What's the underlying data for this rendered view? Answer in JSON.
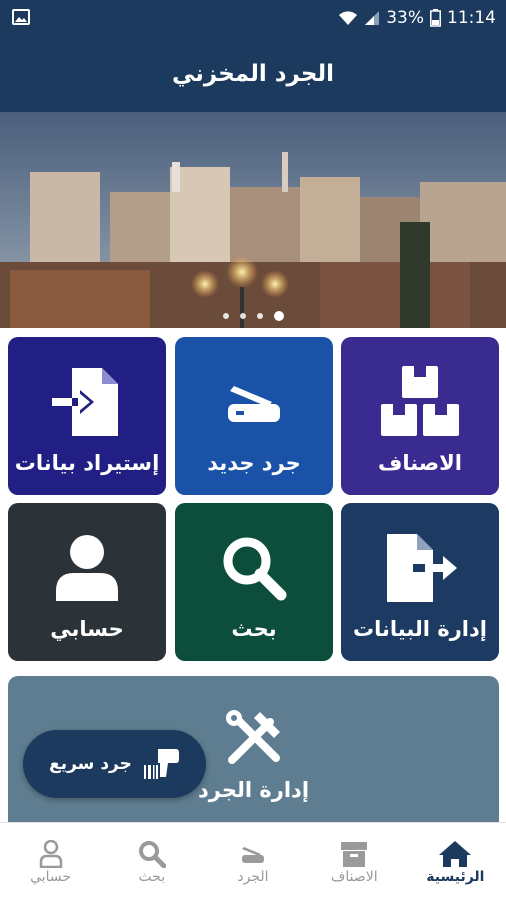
{
  "status_bar": {
    "battery": "33%",
    "time": "11:14"
  },
  "app_bar": {
    "title": "الجرد المخزني"
  },
  "banner": {
    "slides": 4,
    "active_slide": 4
  },
  "tiles": [
    {
      "label": "الاصناف",
      "color": "#3a2b91",
      "icon": "boxes-icon"
    },
    {
      "label": "جرد جديد",
      "color": "#1a52a8",
      "icon": "scanner-icon"
    },
    {
      "label": "إستيراد بيانات",
      "color": "#211f84",
      "icon": "file-import-icon"
    },
    {
      "label": "إدارة البيانات",
      "color": "#1d3a63",
      "icon": "file-export-icon"
    },
    {
      "label": "بحث",
      "color": "#0d4d3c",
      "icon": "search-icon"
    },
    {
      "label": "حسابي",
      "color": "#2c3338",
      "icon": "user-icon"
    }
  ],
  "wide_tile": {
    "label": "إدارة الجرد",
    "color": "#5e7d90",
    "icon": "tools-icon"
  },
  "fab": {
    "label": "جرد سريع",
    "icon": "barcode-scanner-icon"
  },
  "bottom_nav": {
    "items": [
      {
        "label": "الرئيسية",
        "icon": "home-icon",
        "active": true
      },
      {
        "label": "الاصناف",
        "icon": "box-icon",
        "active": false
      },
      {
        "label": "الجرد",
        "icon": "scanner-icon",
        "active": false
      },
      {
        "label": "بحث",
        "icon": "search-icon",
        "active": false
      },
      {
        "label": "حسابي",
        "icon": "user-icon",
        "active": false
      }
    ]
  },
  "colors": {
    "primary": "#1c3a5e",
    "nav_inactive": "#9a9a9a"
  }
}
